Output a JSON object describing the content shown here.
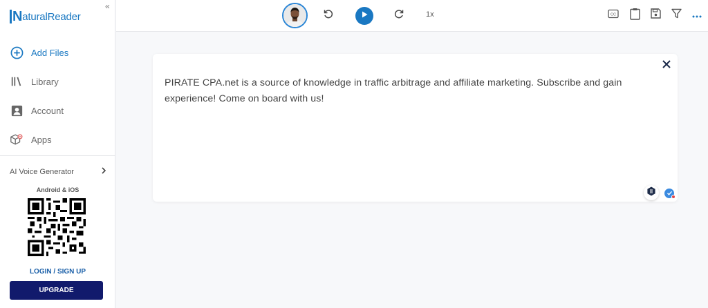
{
  "app": {
    "logo_letter": "N",
    "logo_rest": "aturalReader"
  },
  "sidebar": {
    "collapse_glyph": "«",
    "items": [
      {
        "label": "Add Files",
        "icon": "add-circle-icon",
        "active": true
      },
      {
        "label": "Library",
        "icon": "library-icon",
        "active": false
      },
      {
        "label": "Account",
        "icon": "account-icon",
        "active": false
      },
      {
        "label": "Apps",
        "icon": "apps-icon",
        "active": false
      }
    ],
    "voice_generator": "AI Voice Generator",
    "platform_label": "Android & iOS",
    "login_label": "LOGIN / SIGN UP",
    "upgrade_label": "UPGRADE"
  },
  "toolbar": {
    "speed_label": "1x",
    "icons": [
      "rewind-icon",
      "play-icon",
      "forward-icon",
      "caption-icon",
      "clipboard-icon",
      "save-icon",
      "filter-icon",
      "more-icon"
    ]
  },
  "document": {
    "text": "PIRATE CPA.net is a source of knowledge in traffic arbitrage and affiliate marketing. Subscribe and gain experience! Come on board with us!"
  },
  "colors": {
    "accent": "#1a78c2",
    "upgrade_bg": "#111a6c",
    "background": "#f7f8fa"
  }
}
